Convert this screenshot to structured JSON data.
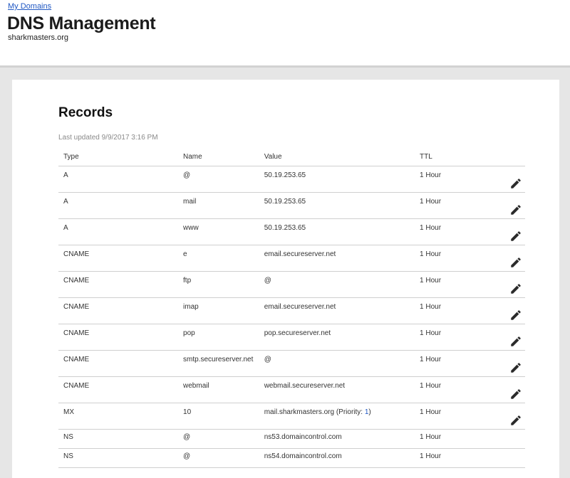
{
  "header": {
    "breadcrumb": "My Domains",
    "title": "DNS Management",
    "domain": "sharkmasters.org"
  },
  "records": {
    "title": "Records",
    "last_updated": "Last updated 9/9/2017 3:16 PM",
    "columns": {
      "type": "Type",
      "name": "Name",
      "value": "Value",
      "ttl": "TTL"
    },
    "rows": [
      {
        "type": "A",
        "name": "@",
        "value": "50.19.253.65",
        "ttl": "1 Hour",
        "editable": true
      },
      {
        "type": "A",
        "name": "mail",
        "value": "50.19.253.65",
        "ttl": "1 Hour",
        "editable": true
      },
      {
        "type": "A",
        "name": "www",
        "value": "50.19.253.65",
        "ttl": "1 Hour",
        "editable": true
      },
      {
        "type": "CNAME",
        "name": "e",
        "value": "email.secureserver.net",
        "ttl": "1 Hour",
        "editable": true
      },
      {
        "type": "CNAME",
        "name": "ftp",
        "value": "@",
        "ttl": "1 Hour",
        "editable": true
      },
      {
        "type": "CNAME",
        "name": "imap",
        "value": "email.secureserver.net",
        "ttl": "1 Hour",
        "editable": true
      },
      {
        "type": "CNAME",
        "name": "pop",
        "value": "pop.secureserver.net",
        "ttl": "1 Hour",
        "editable": true
      },
      {
        "type": "CNAME",
        "name": "smtp.secureserver.net",
        "value": "@",
        "ttl": "1 Hour",
        "editable": true
      },
      {
        "type": "CNAME",
        "name": "webmail",
        "value": "webmail.secureserver.net",
        "ttl": "1 Hour",
        "editable": true
      },
      {
        "type": "MX",
        "name": "10",
        "value": "mail.sharkmasters.org",
        "priority_label": " (Priority: ",
        "priority": "1",
        "priority_close": ")",
        "ttl": "1 Hour",
        "editable": true
      },
      {
        "type": "NS",
        "name": "@",
        "value": "ns53.domaincontrol.com",
        "ttl": "1 Hour",
        "editable": false
      },
      {
        "type": "NS",
        "name": "@",
        "value": "ns54.domaincontrol.com",
        "ttl": "1 Hour",
        "editable": false
      }
    ]
  },
  "icons": {
    "edit": "pencil-icon"
  },
  "colors": {
    "link": "#1f57c3",
    "page_bg": "#e6e6e6"
  }
}
